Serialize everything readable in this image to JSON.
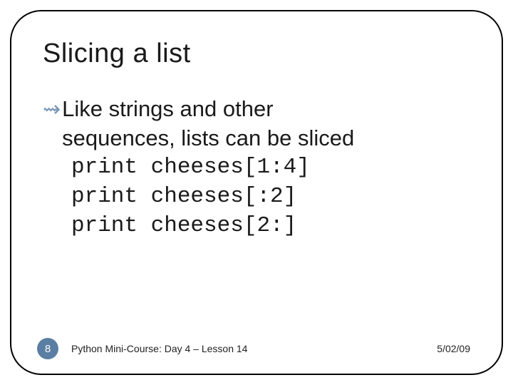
{
  "slide": {
    "title": "Slicing a list",
    "bullet": {
      "glyph": "⇝",
      "line1": "Like strings and other",
      "line2": "sequences, lists can be sliced"
    },
    "code": [
      "print cheeses[1:4]",
      "print cheeses[:2]",
      "print cheeses[2:]"
    ]
  },
  "footer": {
    "page": "8",
    "course": "Python Mini-Course: Day 4 – Lesson 14",
    "date": "5/02/09"
  }
}
